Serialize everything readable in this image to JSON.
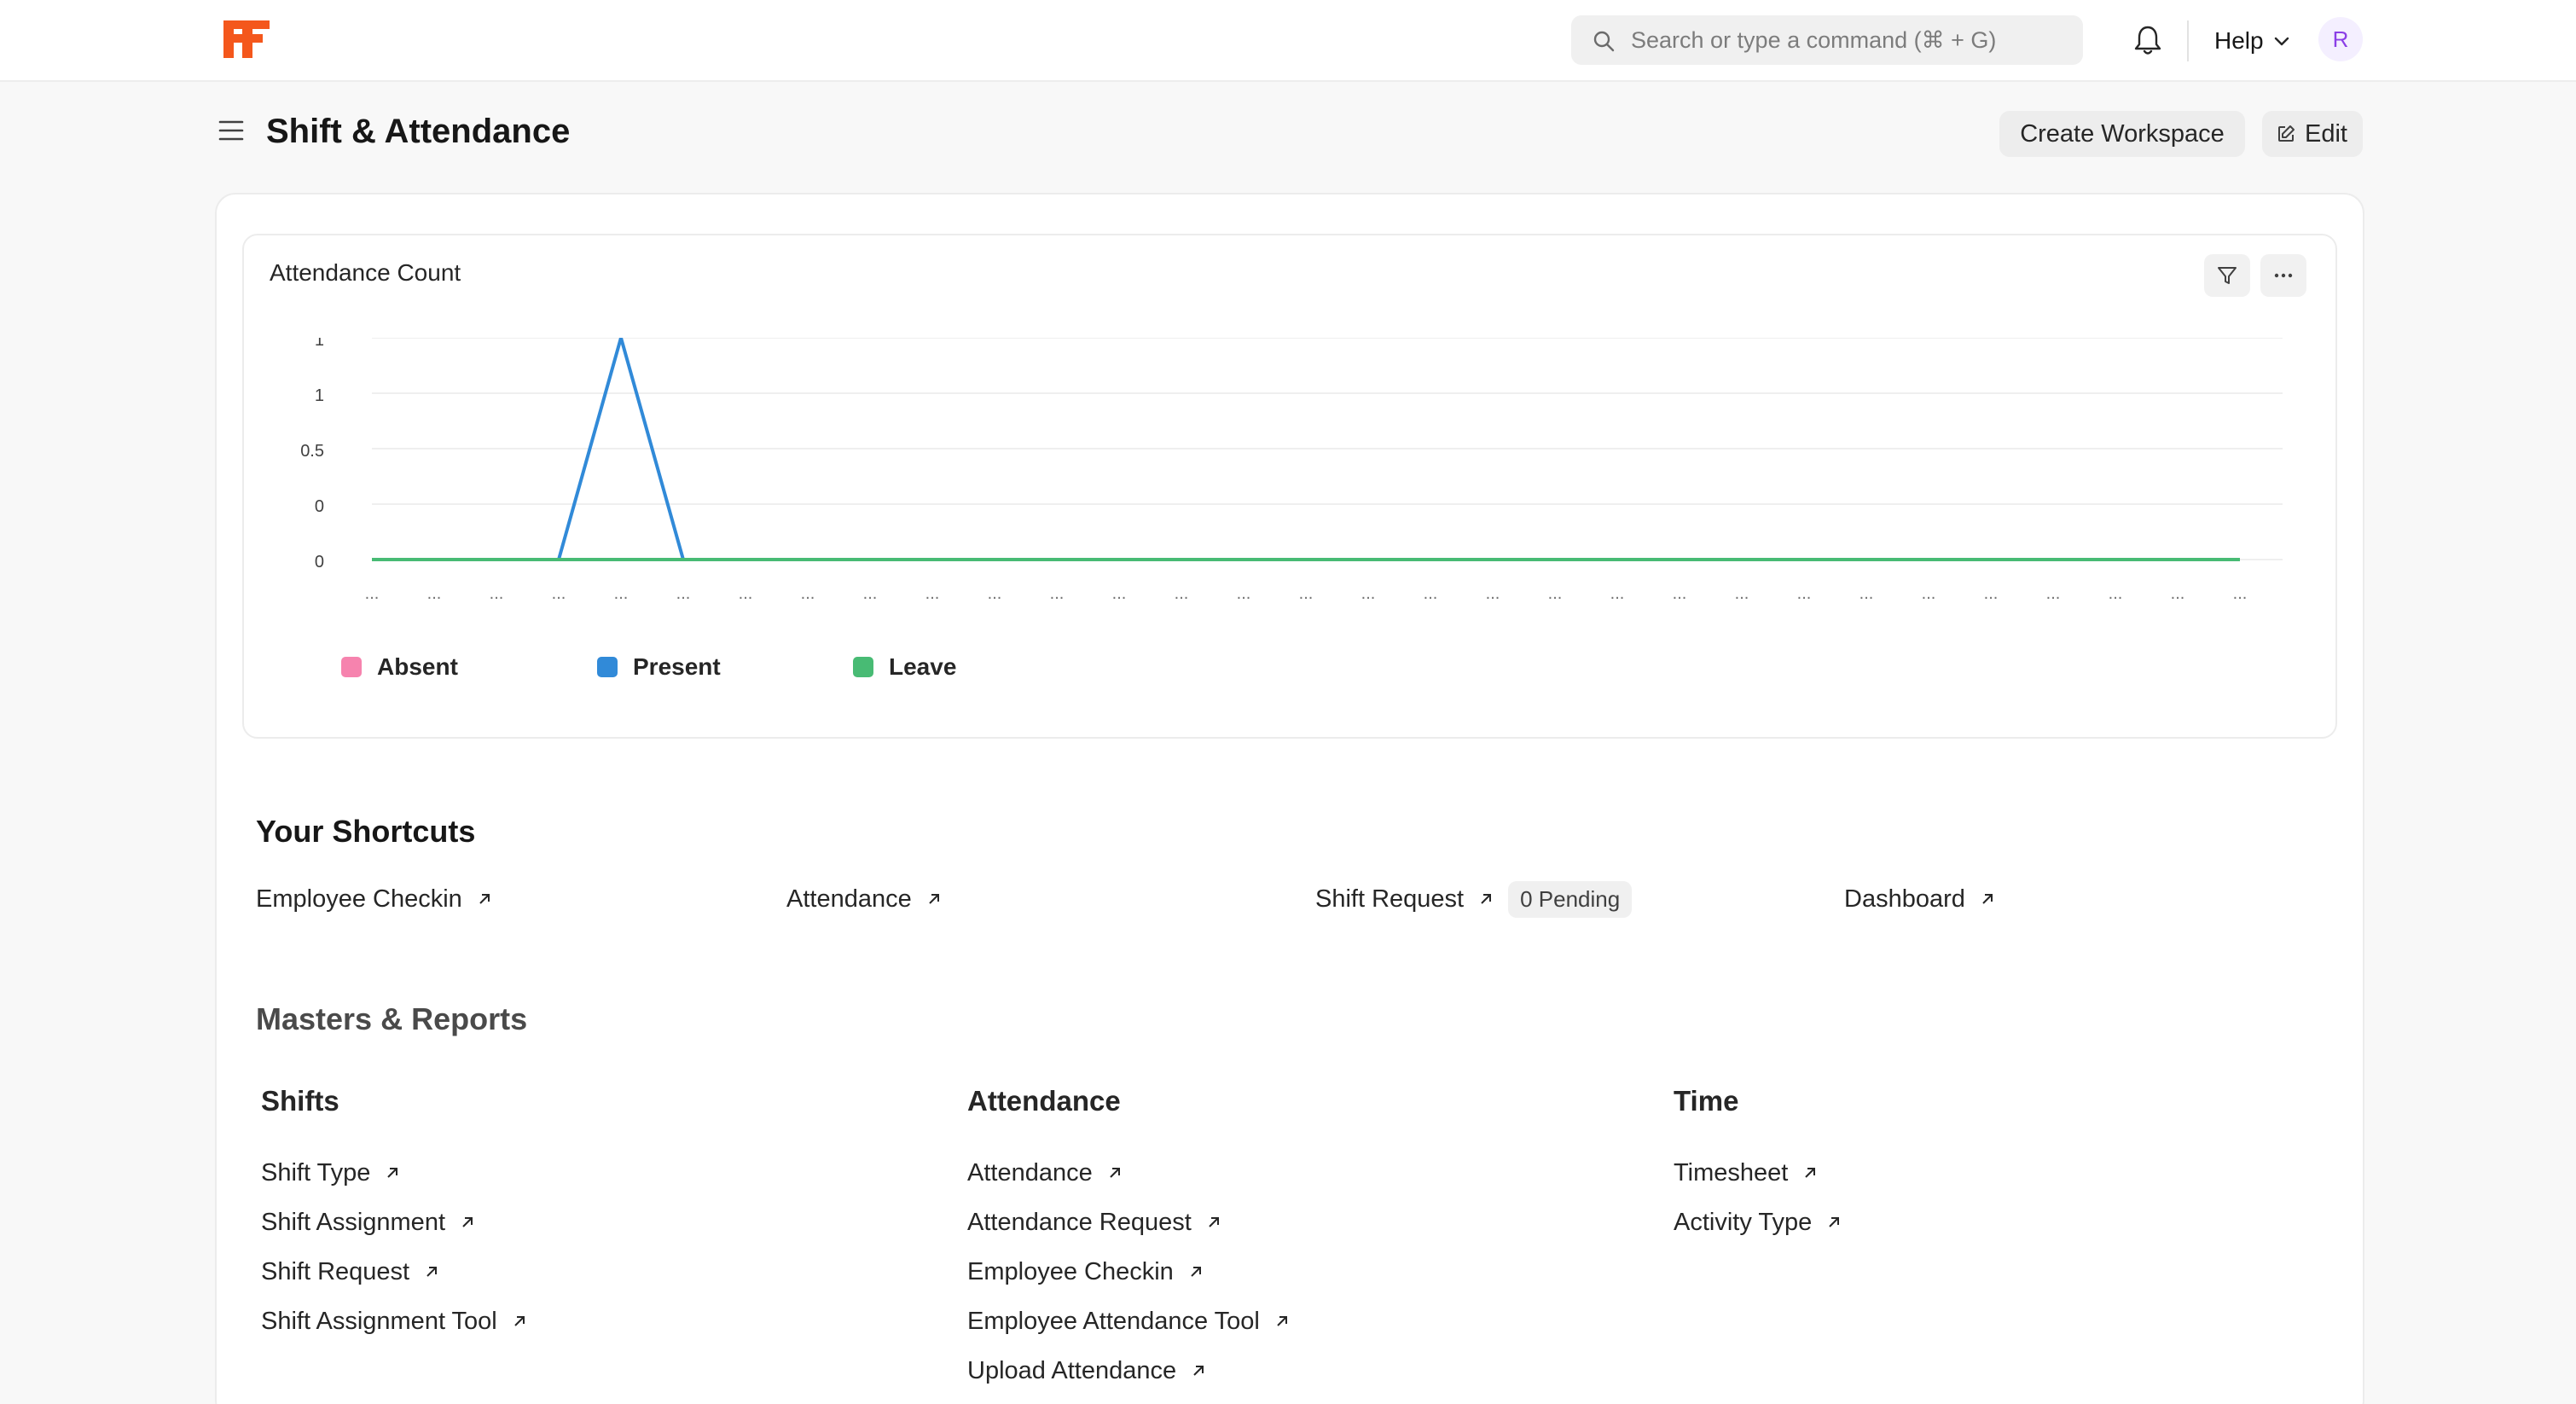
{
  "navbar": {
    "search_placeholder": "Search or type a command (⌘ + G)",
    "help_label": "Help",
    "avatar_initial": "R"
  },
  "page": {
    "title": "Shift & Attendance",
    "create_workspace_label": "Create Workspace",
    "edit_label": "Edit"
  },
  "chart_card": {
    "title": "Attendance Count"
  },
  "chart_data": {
    "type": "line",
    "title": "Attendance Count",
    "x_tick_label": "...",
    "x_count": 31,
    "y_ticks": [
      "1",
      "1",
      "0.5",
      "0",
      "0"
    ],
    "ylim": [
      0,
      1
    ],
    "grid": true,
    "legend_position": "bottom-left",
    "series": [
      {
        "name": "Absent",
        "color": "#f683ae",
        "values": [
          0,
          0,
          0,
          0,
          0,
          0,
          0,
          0,
          0,
          0,
          0,
          0,
          0,
          0,
          0,
          0,
          0,
          0,
          0,
          0,
          0,
          0,
          0,
          0,
          0,
          0,
          0,
          0,
          0,
          0,
          0
        ]
      },
      {
        "name": "Present",
        "color": "#318ad8",
        "values": [
          0,
          0,
          0,
          0,
          1,
          0,
          0,
          0,
          0,
          0,
          0,
          0,
          0,
          0,
          0,
          0,
          0,
          0,
          0,
          0,
          0,
          0,
          0,
          0,
          0,
          0,
          0,
          0,
          0,
          0,
          0
        ]
      },
      {
        "name": "Leave",
        "color": "#48bb74",
        "values": [
          0,
          0,
          0,
          0,
          0,
          0,
          0,
          0,
          0,
          0,
          0,
          0,
          0,
          0,
          0,
          0,
          0,
          0,
          0,
          0,
          0,
          0,
          0,
          0,
          0,
          0,
          0,
          0,
          0,
          0,
          0
        ]
      }
    ]
  },
  "shortcuts": {
    "title": "Your Shortcuts",
    "items": [
      {
        "label": "Employee Checkin"
      },
      {
        "label": "Attendance"
      },
      {
        "label": "Shift Request",
        "badge": "0 Pending"
      },
      {
        "label": "Dashboard"
      }
    ]
  },
  "masters": {
    "title": "Masters & Reports",
    "columns": [
      {
        "title": "Shifts",
        "links": [
          "Shift Type",
          "Shift Assignment",
          "Shift Request",
          "Shift Assignment Tool"
        ]
      },
      {
        "title": "Attendance",
        "links": [
          "Attendance",
          "Attendance Request",
          "Employee Checkin",
          "Employee Attendance Tool",
          "Upload Attendance"
        ]
      },
      {
        "title": "Time",
        "links": [
          "Timesheet",
          "Activity Type"
        ]
      }
    ]
  },
  "colors": {
    "brand": "#f4571c",
    "avatar_text": "#8b3fe6"
  }
}
